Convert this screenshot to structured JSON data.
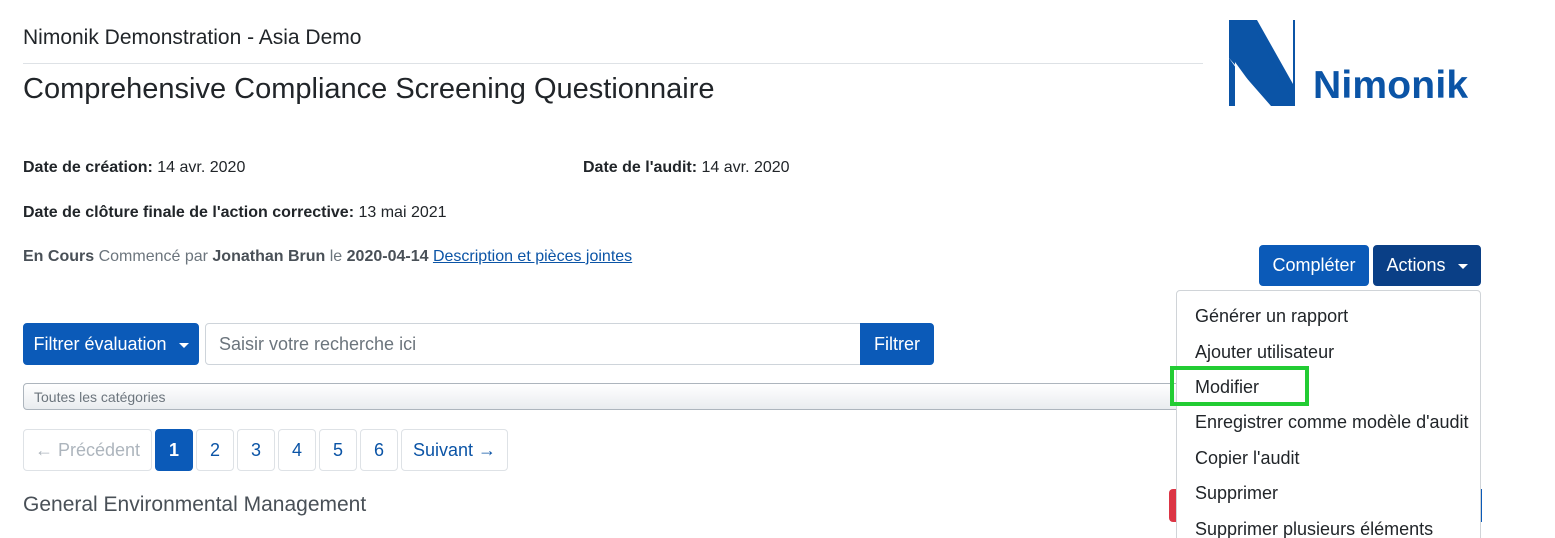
{
  "header": {
    "organization": "Nimonik Demonstration - Asia Demo",
    "title": "Comprehensive Compliance Screening Questionnaire",
    "logo_text": "Nimonik"
  },
  "meta": {
    "creation_label": "Date de création:",
    "creation_value": "14 avr. 2020",
    "audit_label": "Date de l'audit:",
    "audit_value": "14 avr. 2020",
    "closure_label": "Date de clôture finale de l'action corrective:",
    "closure_value": "13 mai 2021"
  },
  "status": {
    "state": "En Cours",
    "started_by_text": "Commencé par",
    "user": "Jonathan Brun",
    "on_text": "le",
    "date": "2020-04-14",
    "link": "Description et pièces jointes"
  },
  "toolbar": {
    "complete_label": "Compléter",
    "actions_label": "Actions"
  },
  "filter": {
    "evaluation_label": "Filtrer évaluation",
    "search_placeholder": "Saisir votre recherche ici",
    "filter_button": "Filtrer",
    "category_select": "Toutes les catégories"
  },
  "pagination": {
    "prev": "← Précédent",
    "pages": [
      "1",
      "2",
      "3",
      "4",
      "5",
      "6"
    ],
    "active_page": "1",
    "next": "Suivant →"
  },
  "section_title": "General Environmental Management",
  "actions_menu": {
    "items": [
      "Générer un rapport",
      "Ajouter utilisateur",
      "Modifier",
      "Enregistrer comme modèle d'audit",
      "Copier l'audit",
      "Supprimer",
      "Supprimer plusieurs éléments"
    ],
    "highlighted_item": "Modifier"
  },
  "colors": {
    "primary": "#0b5ab8",
    "primary_dark": "#0a3f86",
    "brand": "#0b54a6",
    "highlight": "#22cc33",
    "danger": "#dc3545"
  }
}
